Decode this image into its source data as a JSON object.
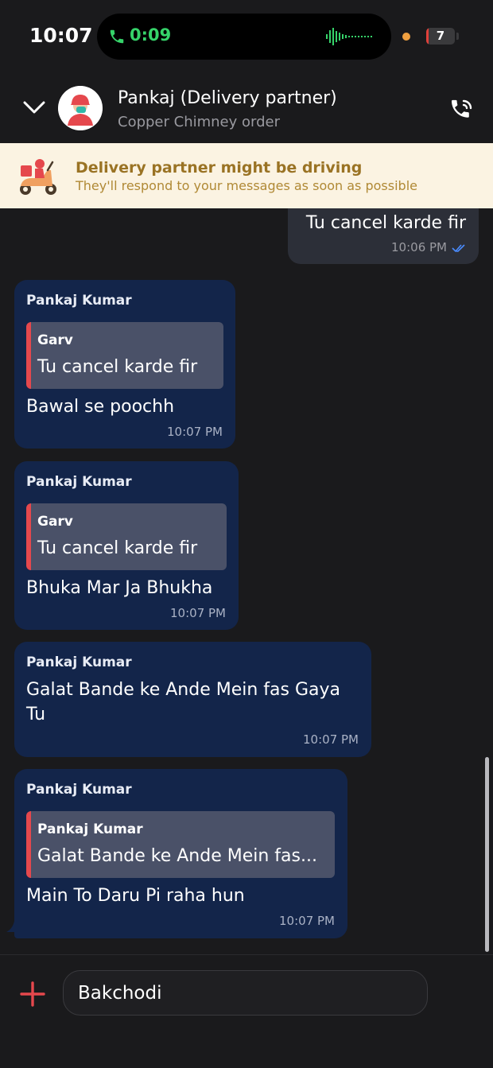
{
  "status_bar": {
    "time": "10:07",
    "call_timer": "0:09",
    "battery_level": "7",
    "battery_percent": 7
  },
  "header": {
    "contact_name": "Pankaj (Delivery partner)",
    "subtitle": "Copper Chimney order"
  },
  "banner": {
    "title": "Delivery partner might be driving",
    "text": "They'll respond to your messages as soon as possible"
  },
  "messages": [
    {
      "direction": "outgoing",
      "text": "Tu cancel karde fir",
      "time": "10:06 PM",
      "status": "read"
    },
    {
      "direction": "incoming",
      "sender": "Pankaj Kumar",
      "quote_author": "Garv",
      "quote_text": "Tu cancel karde fir",
      "text": "Bawal se poochh",
      "time": "10:07 PM"
    },
    {
      "direction": "incoming",
      "sender": "Pankaj Kumar",
      "quote_author": "Garv",
      "quote_text": "Tu cancel karde fir",
      "text": "Bhuka Mar Ja Bhukha",
      "time": "10:07 PM"
    },
    {
      "direction": "incoming",
      "sender": "Pankaj Kumar",
      "text_line1": "Galat Bande ke Ande Mein fas Gaya",
      "text_line2": "Tu",
      "time": "10:07 PM"
    },
    {
      "direction": "incoming",
      "sender": "Pankaj Kumar",
      "quote_author": "Pankaj Kumar",
      "quote_text": "Galat Bande ke Ande Mein fas...",
      "text": "Main To Daru Pi raha hun",
      "time": "10:07 PM"
    }
  ],
  "composer": {
    "input_value": "Bakchodi"
  },
  "colors": {
    "background": "#1a1a1c",
    "incoming_bubble": "#13254a",
    "outgoing_bubble": "#2c2f38",
    "quote_bar": "#e5484d",
    "banner_bg": "#fbf3e2",
    "banner_title": "#9a7324",
    "call_green": "#36d36a",
    "accent_red": "#e5484d"
  }
}
